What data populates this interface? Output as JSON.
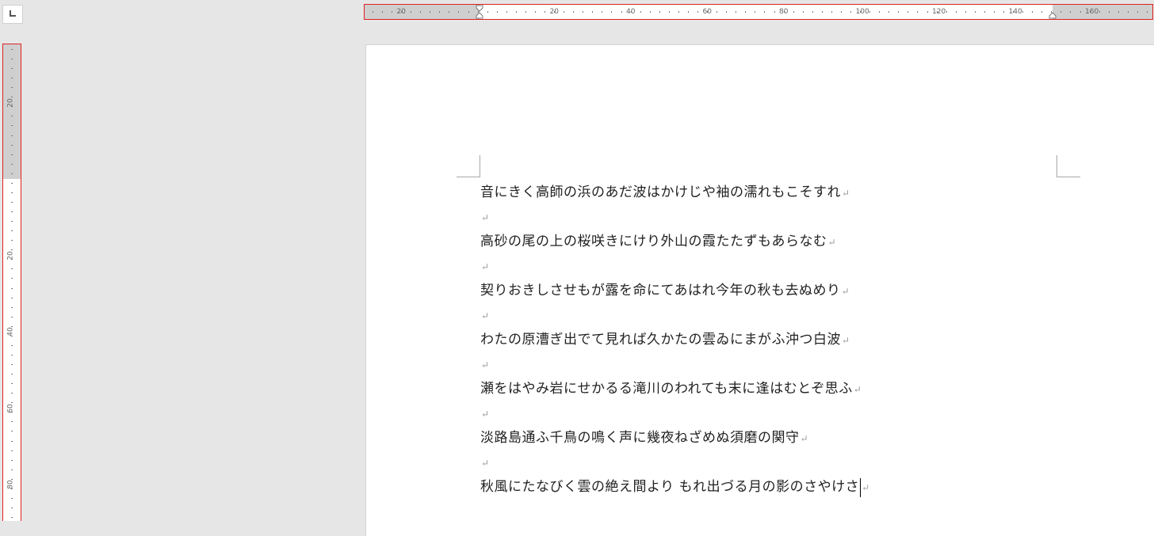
{
  "ruler": {
    "horizontal_labels": [
      "20",
      "20",
      "40",
      "60",
      "80",
      "100",
      "120",
      "140",
      "160"
    ],
    "vertical_labels": [
      "20",
      "20",
      "40",
      "60",
      "80"
    ]
  },
  "paragraph_mark": "↵",
  "document": {
    "paragraphs": [
      "音にきく高師の浜のあだ波はかけじや袖の濡れもこそすれ",
      "",
      "高砂の尾の上の桜咲きにけり外山の霞たたずもあらなむ",
      "",
      "契りおきしさせもが露を命にてあはれ今年の秋も去ぬめり",
      "",
      "わたの原漕ぎ出でて見れば久かたの雲ゐにまがふ沖つ白波",
      "",
      "瀬をはやみ岩にせかるる滝川のわれても末に逢はむとぞ思ふ",
      "",
      "淡路島通ふ千鳥の鳴く声に幾夜ねざめぬ須磨の関守",
      "",
      "秋風にたなびく雲の絶え間より もれ出づる月の影のさやけさ"
    ]
  },
  "colors": {
    "highlight_border": "#e02020",
    "workspace": "#e6e6e6",
    "ruler_margin": "#cfcfcf"
  },
  "icons": {
    "tab_selector": "left-tab-stop-icon",
    "indent": "indent-marker-icon"
  }
}
